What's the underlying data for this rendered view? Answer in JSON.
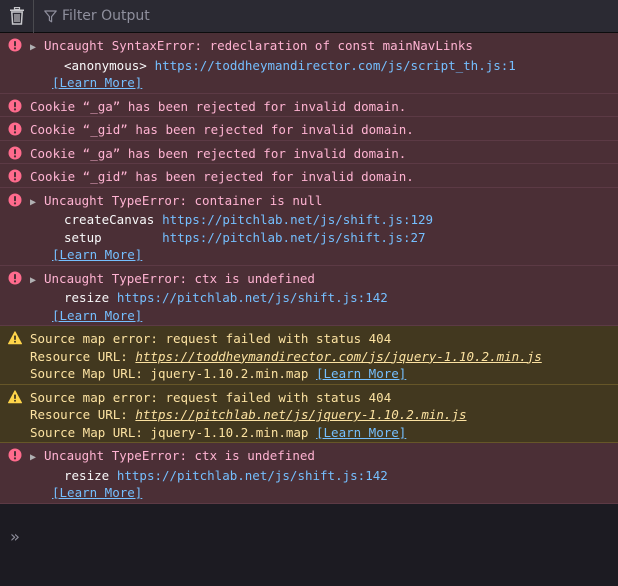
{
  "toolbar": {
    "trash_icon": "trash-icon",
    "filter_icon": "filter-icon",
    "filter_placeholder": "Filter Output"
  },
  "messages": [
    {
      "type": "error",
      "text": "Uncaught SyntaxError: redeclaration of const mainNavLinks",
      "frames": [
        {
          "name": "<anonymous>",
          "url": "https://toddheymandirector.com/js/script_th.js:1"
        }
      ],
      "learn_more": "[Learn More]"
    },
    {
      "type": "error",
      "text": "Cookie “_ga” has been rejected for invalid domain."
    },
    {
      "type": "error",
      "text": "Cookie “_gid” has been rejected for invalid domain."
    },
    {
      "type": "error",
      "text": "Cookie “_ga” has been rejected for invalid domain."
    },
    {
      "type": "error",
      "text": "Cookie “_gid” has been rejected for invalid domain."
    },
    {
      "type": "error",
      "text": "Uncaught TypeError: container is null",
      "frames": [
        {
          "name": "createCanvas",
          "url": "https://pitchlab.net/js/shift.js:129"
        },
        {
          "name": "setup",
          "url": "https://pitchlab.net/js/shift.js:27"
        }
      ],
      "learn_more": "[Learn More]"
    },
    {
      "type": "error",
      "text": "Uncaught TypeError: ctx is undefined",
      "frames": [
        {
          "name": "resize",
          "url": "https://pitchlab.net/js/shift.js:142"
        }
      ],
      "learn_more": "[Learn More]"
    },
    {
      "type": "warning",
      "text": "Source map error: request failed with status 404",
      "resource_label": "Resource URL:",
      "resource_url": "https://toddheymandirector.com/js/jquery-1.10.2.min.js",
      "sourcemap_label": "Source Map URL:",
      "sourcemap_value": "jquery-1.10.2.min.map",
      "learn_more": "[Learn More]"
    },
    {
      "type": "warning",
      "text": "Source map error: request failed with status 404",
      "resource_label": "Resource URL:",
      "resource_url": "https://pitchlab.net/js/jquery-1.10.2.min.js",
      "sourcemap_label": "Source Map URL:",
      "sourcemap_value": "jquery-1.10.2.min.map",
      "learn_more": "[Learn More]"
    },
    {
      "type": "error",
      "text": "Uncaught TypeError: ctx is undefined",
      "frames": [
        {
          "name": "resize",
          "url": "https://pitchlab.net/js/shift.js:142"
        }
      ],
      "learn_more": "[Learn More]"
    }
  ],
  "input": {
    "prompt_icon": "double-chevron-right-icon",
    "prompt_glyph": "»"
  },
  "colors": {
    "error_bg": "#4b2f36",
    "error_text": "#ffb3d2",
    "warning_bg": "#42381f",
    "warning_text": "#fce2a1",
    "link": "#75bfff",
    "toolbar_bg": "#2b2a33"
  }
}
